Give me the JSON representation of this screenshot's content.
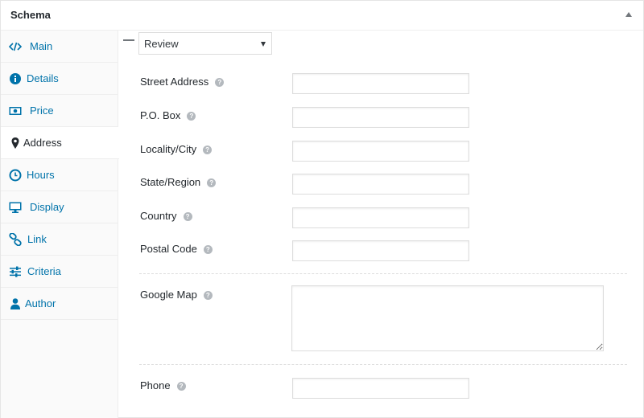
{
  "panel": {
    "title": "Schema",
    "toggle_icon": "triangle-up-icon"
  },
  "sidebar": {
    "items": [
      {
        "label": "Main",
        "icon": "code-icon",
        "active": false
      },
      {
        "label": "Details",
        "icon": "info-icon",
        "active": false
      },
      {
        "label": "Price",
        "icon": "money-icon",
        "active": false
      },
      {
        "label": "Address",
        "icon": "location-pin-icon",
        "active": true
      },
      {
        "label": "Hours",
        "icon": "clock-icon",
        "active": false
      },
      {
        "label": "Display",
        "icon": "monitor-icon",
        "active": false
      },
      {
        "label": "Link",
        "icon": "link-icon",
        "active": false
      },
      {
        "label": "Criteria",
        "icon": "sliders-icon",
        "active": false
      },
      {
        "label": "Author",
        "icon": "user-icon",
        "active": false
      }
    ]
  },
  "content": {
    "type_select": {
      "value": "Review"
    },
    "fields": [
      {
        "label": "Street Address",
        "value": ""
      },
      {
        "label": "P.O. Box",
        "value": ""
      },
      {
        "label": "Locality/City",
        "value": ""
      },
      {
        "label": "State/Region",
        "value": ""
      },
      {
        "label": "Country",
        "value": ""
      },
      {
        "label": "Postal Code",
        "value": ""
      }
    ],
    "google_map": {
      "label": "Google Map",
      "value": ""
    },
    "phone": {
      "label": "Phone",
      "value": ""
    },
    "help_glyph": "?"
  },
  "colors": {
    "link": "#0073aa",
    "text": "#23282d",
    "border": "#dddddd",
    "sidebar_bg": "#fafafa",
    "help_bg": "#b4b9be"
  }
}
